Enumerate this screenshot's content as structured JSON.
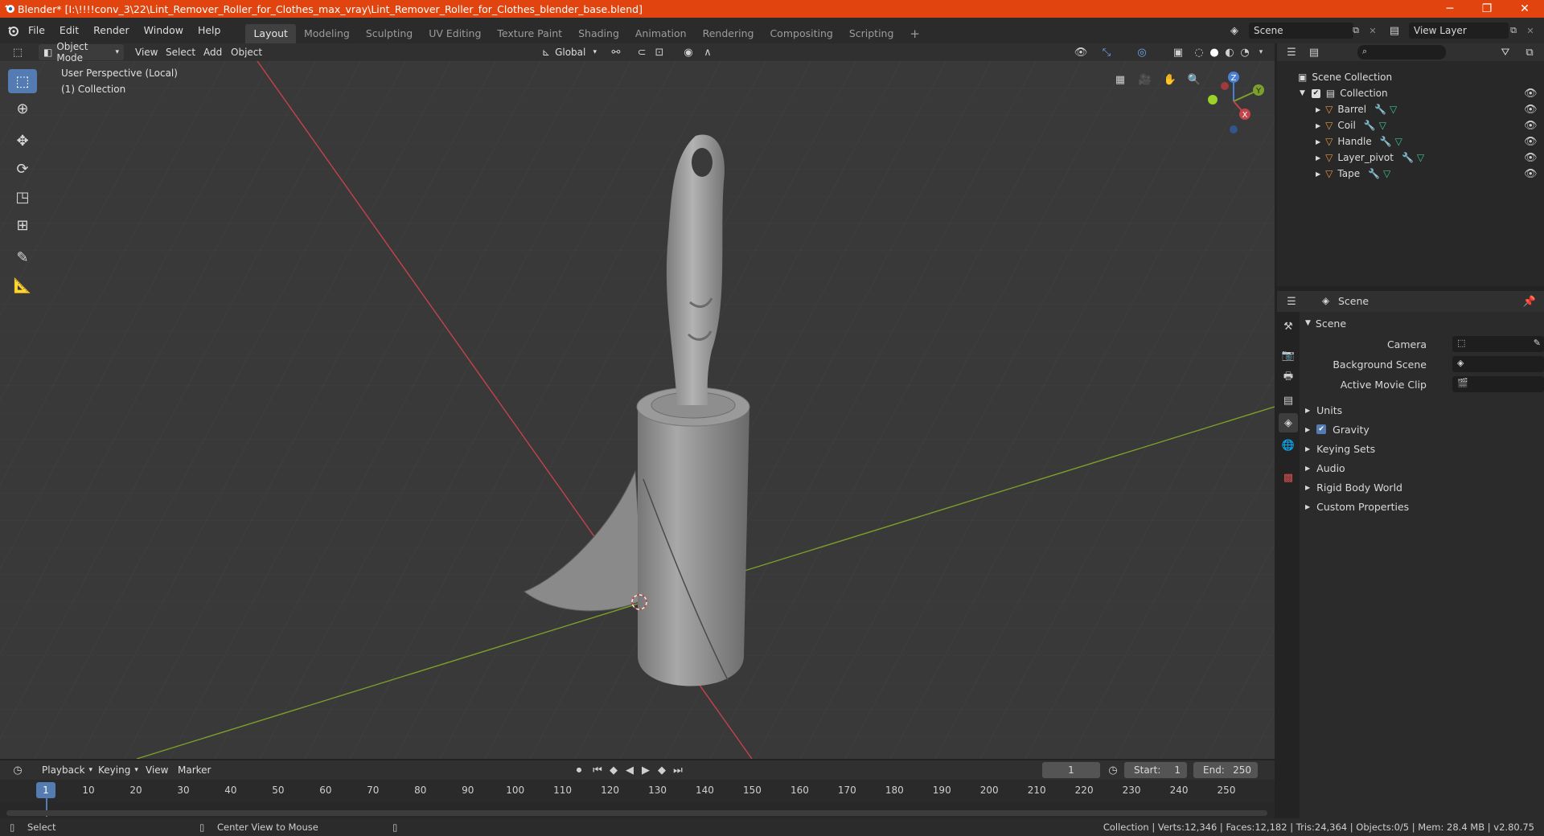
{
  "window": {
    "title": "Blender* [I:\\!!!!conv_3\\22\\Lint_Remover_Roller_for_Clothes_max_vray\\Lint_Remover_Roller_for_Clothes_blender_base.blend]",
    "minimize": "─",
    "maximize": "❐",
    "close": "✕"
  },
  "menu": [
    "File",
    "Edit",
    "Render",
    "Window",
    "Help"
  ],
  "workspaces": [
    {
      "label": "Layout",
      "active": true
    },
    {
      "label": "Modeling"
    },
    {
      "label": "Sculpting"
    },
    {
      "label": "UV Editing"
    },
    {
      "label": "Texture Paint"
    },
    {
      "label": "Shading"
    },
    {
      "label": "Animation"
    },
    {
      "label": "Rendering"
    },
    {
      "label": "Compositing"
    },
    {
      "label": "Scripting"
    }
  ],
  "add_workspace": "+",
  "scene_selector": {
    "value": "Scene"
  },
  "view_layer_selector": {
    "value": "View Layer"
  },
  "viewport_header": {
    "mode": "Object Mode",
    "menus": [
      "View",
      "Select",
      "Add",
      "Object"
    ],
    "transform_orientation": "Global"
  },
  "viewport": {
    "perspective_label": "User Perspective (Local)",
    "collection_label": "(1) Collection",
    "gizmo": {
      "z": "Z",
      "y": "Y",
      "x": "X"
    }
  },
  "outliner": {
    "root": "Scene Collection",
    "collection": "Collection",
    "objects": [
      "Barrel",
      "Coil",
      "Handle",
      "Layer_pivot",
      "Tape"
    ]
  },
  "properties": {
    "context": "Scene",
    "panel_title": "Scene",
    "fields": [
      {
        "label": "Camera"
      },
      {
        "label": "Background Scene"
      },
      {
        "label": "Active Movie Clip"
      }
    ],
    "sections": [
      "Units",
      "Gravity",
      "Keying Sets",
      "Audio",
      "Rigid Body World",
      "Custom Properties"
    ]
  },
  "timeline": {
    "menus": [
      "Playback",
      "Keying",
      "View",
      "Marker"
    ],
    "current_frame": "1",
    "start_label": "Start:",
    "start": "1",
    "end_label": "End:",
    "end": "250",
    "ruler": [
      "1",
      "10",
      "20",
      "30",
      "40",
      "50",
      "60",
      "70",
      "80",
      "90",
      "100",
      "110",
      "120",
      "130",
      "140",
      "150",
      "160",
      "170",
      "180",
      "190",
      "200",
      "210",
      "220",
      "230",
      "240",
      "250"
    ]
  },
  "statusbar": {
    "left_action": "Select",
    "middle_action": "Center View to Mouse",
    "stats": "Collection | Verts:12,346 | Faces:12,182 | Tris:24,364 | Objects:0/5 | Mem: 28.4 MB | v2.80.75"
  },
  "colors": {
    "accent": "#547cb3",
    "titlebar": "#e1440e",
    "axis_x": "#c4434a",
    "axis_y": "#7ca02a"
  }
}
